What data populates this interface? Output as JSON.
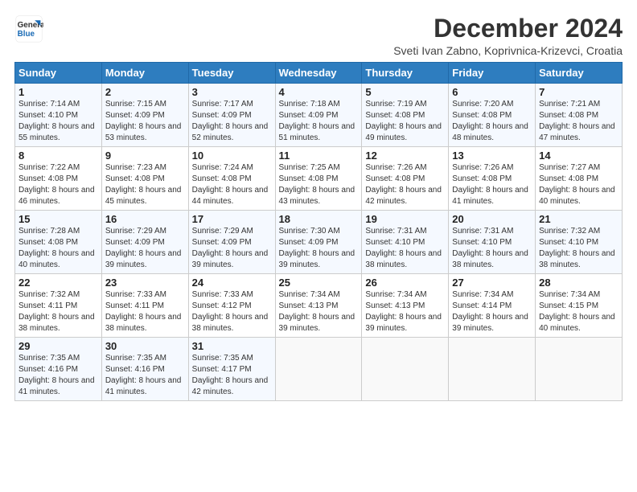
{
  "header": {
    "logo_line1": "General",
    "logo_line2": "Blue",
    "title": "December 2024",
    "subtitle": "Sveti Ivan Zabno, Koprivnica-Krizevci, Croatia"
  },
  "weekdays": [
    "Sunday",
    "Monday",
    "Tuesday",
    "Wednesday",
    "Thursday",
    "Friday",
    "Saturday"
  ],
  "weeks": [
    [
      {
        "day": "1",
        "sunrise": "Sunrise: 7:14 AM",
        "sunset": "Sunset: 4:10 PM",
        "daylight": "Daylight: 8 hours and 55 minutes."
      },
      {
        "day": "2",
        "sunrise": "Sunrise: 7:15 AM",
        "sunset": "Sunset: 4:09 PM",
        "daylight": "Daylight: 8 hours and 53 minutes."
      },
      {
        "day": "3",
        "sunrise": "Sunrise: 7:17 AM",
        "sunset": "Sunset: 4:09 PM",
        "daylight": "Daylight: 8 hours and 52 minutes."
      },
      {
        "day": "4",
        "sunrise": "Sunrise: 7:18 AM",
        "sunset": "Sunset: 4:09 PM",
        "daylight": "Daylight: 8 hours and 51 minutes."
      },
      {
        "day": "5",
        "sunrise": "Sunrise: 7:19 AM",
        "sunset": "Sunset: 4:08 PM",
        "daylight": "Daylight: 8 hours and 49 minutes."
      },
      {
        "day": "6",
        "sunrise": "Sunrise: 7:20 AM",
        "sunset": "Sunset: 4:08 PM",
        "daylight": "Daylight: 8 hours and 48 minutes."
      },
      {
        "day": "7",
        "sunrise": "Sunrise: 7:21 AM",
        "sunset": "Sunset: 4:08 PM",
        "daylight": "Daylight: 8 hours and 47 minutes."
      }
    ],
    [
      {
        "day": "8",
        "sunrise": "Sunrise: 7:22 AM",
        "sunset": "Sunset: 4:08 PM",
        "daylight": "Daylight: 8 hours and 46 minutes."
      },
      {
        "day": "9",
        "sunrise": "Sunrise: 7:23 AM",
        "sunset": "Sunset: 4:08 PM",
        "daylight": "Daylight: 8 hours and 45 minutes."
      },
      {
        "day": "10",
        "sunrise": "Sunrise: 7:24 AM",
        "sunset": "Sunset: 4:08 PM",
        "daylight": "Daylight: 8 hours and 44 minutes."
      },
      {
        "day": "11",
        "sunrise": "Sunrise: 7:25 AM",
        "sunset": "Sunset: 4:08 PM",
        "daylight": "Daylight: 8 hours and 43 minutes."
      },
      {
        "day": "12",
        "sunrise": "Sunrise: 7:26 AM",
        "sunset": "Sunset: 4:08 PM",
        "daylight": "Daylight: 8 hours and 42 minutes."
      },
      {
        "day": "13",
        "sunrise": "Sunrise: 7:26 AM",
        "sunset": "Sunset: 4:08 PM",
        "daylight": "Daylight: 8 hours and 41 minutes."
      },
      {
        "day": "14",
        "sunrise": "Sunrise: 7:27 AM",
        "sunset": "Sunset: 4:08 PM",
        "daylight": "Daylight: 8 hours and 40 minutes."
      }
    ],
    [
      {
        "day": "15",
        "sunrise": "Sunrise: 7:28 AM",
        "sunset": "Sunset: 4:08 PM",
        "daylight": "Daylight: 8 hours and 40 minutes."
      },
      {
        "day": "16",
        "sunrise": "Sunrise: 7:29 AM",
        "sunset": "Sunset: 4:09 PM",
        "daylight": "Daylight: 8 hours and 39 minutes."
      },
      {
        "day": "17",
        "sunrise": "Sunrise: 7:29 AM",
        "sunset": "Sunset: 4:09 PM",
        "daylight": "Daylight: 8 hours and 39 minutes."
      },
      {
        "day": "18",
        "sunrise": "Sunrise: 7:30 AM",
        "sunset": "Sunset: 4:09 PM",
        "daylight": "Daylight: 8 hours and 39 minutes."
      },
      {
        "day": "19",
        "sunrise": "Sunrise: 7:31 AM",
        "sunset": "Sunset: 4:10 PM",
        "daylight": "Daylight: 8 hours and 38 minutes."
      },
      {
        "day": "20",
        "sunrise": "Sunrise: 7:31 AM",
        "sunset": "Sunset: 4:10 PM",
        "daylight": "Daylight: 8 hours and 38 minutes."
      },
      {
        "day": "21",
        "sunrise": "Sunrise: 7:32 AM",
        "sunset": "Sunset: 4:10 PM",
        "daylight": "Daylight: 8 hours and 38 minutes."
      }
    ],
    [
      {
        "day": "22",
        "sunrise": "Sunrise: 7:32 AM",
        "sunset": "Sunset: 4:11 PM",
        "daylight": "Daylight: 8 hours and 38 minutes."
      },
      {
        "day": "23",
        "sunrise": "Sunrise: 7:33 AM",
        "sunset": "Sunset: 4:11 PM",
        "daylight": "Daylight: 8 hours and 38 minutes."
      },
      {
        "day": "24",
        "sunrise": "Sunrise: 7:33 AM",
        "sunset": "Sunset: 4:12 PM",
        "daylight": "Daylight: 8 hours and 38 minutes."
      },
      {
        "day": "25",
        "sunrise": "Sunrise: 7:34 AM",
        "sunset": "Sunset: 4:13 PM",
        "daylight": "Daylight: 8 hours and 39 minutes."
      },
      {
        "day": "26",
        "sunrise": "Sunrise: 7:34 AM",
        "sunset": "Sunset: 4:13 PM",
        "daylight": "Daylight: 8 hours and 39 minutes."
      },
      {
        "day": "27",
        "sunrise": "Sunrise: 7:34 AM",
        "sunset": "Sunset: 4:14 PM",
        "daylight": "Daylight: 8 hours and 39 minutes."
      },
      {
        "day": "28",
        "sunrise": "Sunrise: 7:34 AM",
        "sunset": "Sunset: 4:15 PM",
        "daylight": "Daylight: 8 hours and 40 minutes."
      }
    ],
    [
      {
        "day": "29",
        "sunrise": "Sunrise: 7:35 AM",
        "sunset": "Sunset: 4:16 PM",
        "daylight": "Daylight: 8 hours and 41 minutes."
      },
      {
        "day": "30",
        "sunrise": "Sunrise: 7:35 AM",
        "sunset": "Sunset: 4:16 PM",
        "daylight": "Daylight: 8 hours and 41 minutes."
      },
      {
        "day": "31",
        "sunrise": "Sunrise: 7:35 AM",
        "sunset": "Sunset: 4:17 PM",
        "daylight": "Daylight: 8 hours and 42 minutes."
      },
      null,
      null,
      null,
      null
    ]
  ]
}
